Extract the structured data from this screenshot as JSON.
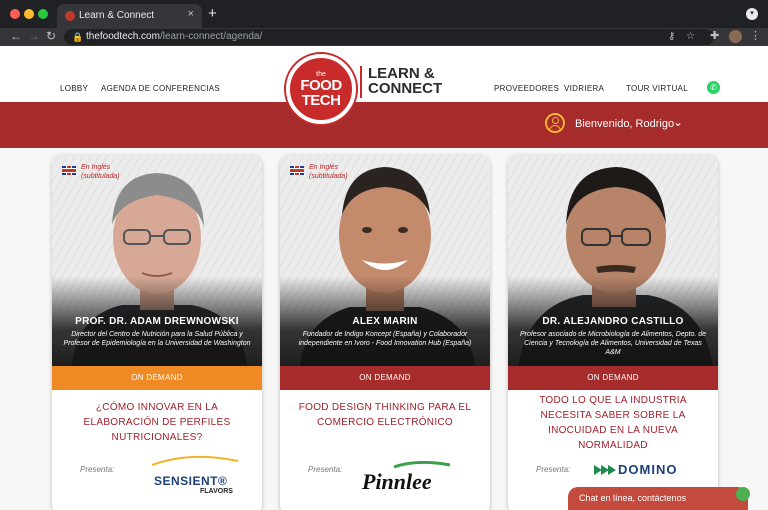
{
  "browser": {
    "tab_title": "Learn & Connect",
    "tab_close": "×",
    "new_tab": "+",
    "url_host": "thefoodtech.com",
    "url_path": "/learn-connect/agenda/"
  },
  "nav": {
    "lobby": "LOBBY",
    "agenda": "AGENDA DE CONFERENCIAS",
    "proveedores": "PROVEEDORES",
    "vidriera": "VIDRIERA",
    "tour": "TOUR VIRTUAL"
  },
  "logo": {
    "the": "the",
    "food": "FOOD",
    "tech": "TECH",
    "brand_line1": "LEARN &",
    "brand_line2": "CONNECT"
  },
  "user": {
    "welcome": "Bienvenido, Rodrigo"
  },
  "colors": {
    "brand_red": "#a62b2b",
    "demand_orange": "#f08a24",
    "demand_red": "#a62b2b",
    "title_red": "#a11f2a"
  },
  "cards": [
    {
      "lang_line1": "En Inglés",
      "lang_line2": "(subtitulada)",
      "name": "PROF. DR. ADAM DREWNOWSKI",
      "role": "Director del Centro de Nutrición para la Salud Pública y Profesor de Epidemiología en la Universidad de Washington",
      "status": "ON DEMAND",
      "title": "¿CÓMO INNOVAR EN LA ELABORACIÓN DE PERFILES NUTRICIONALES?",
      "presenta": "Presenta:",
      "sponsor_line1": "SENSIENT®",
      "sponsor_line2": "FLAVORS"
    },
    {
      "lang_line1": "En Inglés",
      "lang_line2": "(subtitulada)",
      "name": "ALEX MARIN",
      "role": "Fundador de Indigo Koncept (España) y Colaborador independiente en Ivoro - Food Innovation Hub (España)",
      "status": "ON DEMAND",
      "title": "FOOD DESIGN THINKING PARA EL COMERCIO ELECTRÓNICO",
      "presenta": "Presenta:",
      "sponsor_line1": "Pinnlee"
    },
    {
      "name": "DR. ALEJANDRO CASTILLO",
      "role": "Profesor asociado de Microbiología de Alimentos, Depto. de Ciencia y Tecnología de Alimentos, Universidad de Texas A&M",
      "status": "ON DEMAND",
      "title": "TODO LO QUE LA INDUSTRIA NECESITA SABER SOBRE LA INOCUIDAD EN LA NUEVA NORMALIDAD",
      "presenta": "Presenta:",
      "sponsor_line1": "DOMINO"
    }
  ],
  "chat": {
    "label": "Chat en línea, contáctenos"
  }
}
